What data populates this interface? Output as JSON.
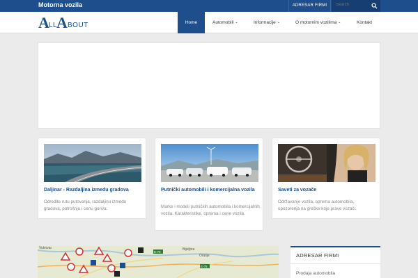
{
  "topbar": {
    "brand": "Motorna vozila",
    "adresar_link": "ADRESAR FIRMI",
    "search_placeholder": "Search"
  },
  "logo": {
    "part1": "A",
    "part2": "LL",
    "part3": "A",
    "part4": "BOUT"
  },
  "nav": {
    "items": [
      {
        "label": "Home",
        "active": true
      },
      {
        "label": "Automobili",
        "dropdown": true
      },
      {
        "label": "Informacije",
        "dropdown": true
      },
      {
        "label": "O motornim vozilima",
        "dropdown": true
      },
      {
        "label": "Kontakt"
      }
    ]
  },
  "cards": [
    {
      "title": "Daljinar - Razdaljina izmedu gradova",
      "desc": "Odredite rutu putovanja, razdaljinu izmedu gradova, potrošnju i cenu goriva."
    },
    {
      "title": "Putnički automobili i komercijalna vozila",
      "desc": "Marke i modeli putničkih automobila i komercijalnih vozila. Karakteristike, oprema i cene vozila."
    },
    {
      "title": "Saveti za vozače",
      "desc": "Održavanje vozila, oprema automobila, upozorenja na greške koje prave vozači."
    }
  ],
  "map": {
    "labels": [
      "Vukovar",
      "Bijeljina",
      "Orašje",
      "E-70",
      "E-75"
    ]
  },
  "sidebar": {
    "widget_title": "ADRESAR FIRMI",
    "first_item": "Prodaja automobila"
  },
  "colors": {
    "primary": "#1e4e8c",
    "background": "#ebebeb"
  }
}
